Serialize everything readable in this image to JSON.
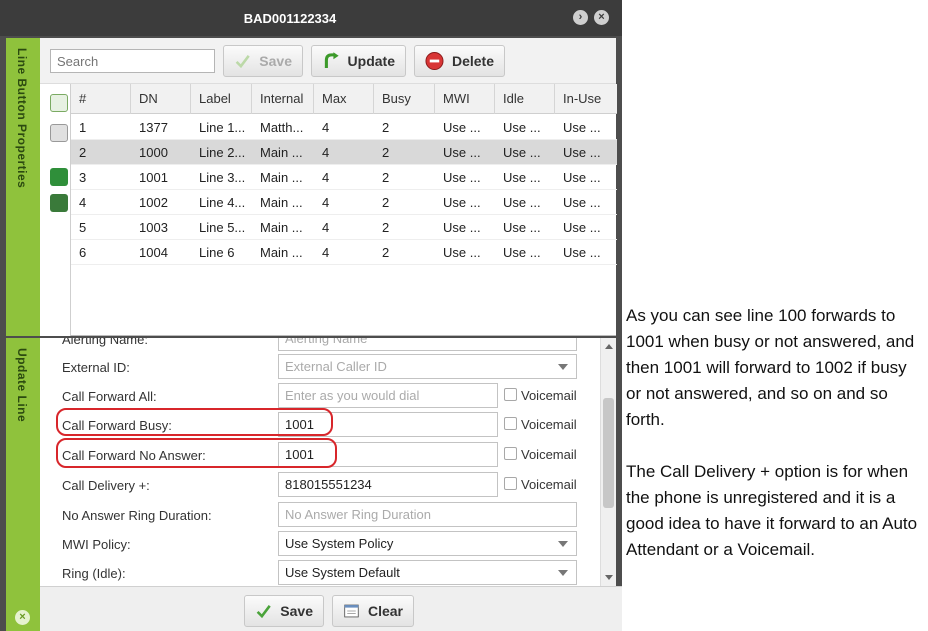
{
  "window": {
    "title": "BAD001122334",
    "tabs": {
      "line_button_properties": "Line Button Properties",
      "update_line": "Update Line"
    }
  },
  "toolbar": {
    "search_placeholder": "Search",
    "save_label": "Save",
    "update_label": "Update",
    "delete_label": "Delete"
  },
  "grid": {
    "columns": [
      "#",
      "DN",
      "Label",
      "Internal",
      "Max",
      "Busy",
      "MWI",
      "Idle",
      "In-Use"
    ],
    "rows": [
      [
        "1",
        "1377",
        "Line 1...",
        "Matth...",
        "4",
        "2",
        "Use ...",
        "Use ...",
        "Use ..."
      ],
      [
        "2",
        "1000",
        "Line 2...",
        "Main ...",
        "4",
        "2",
        "Use ...",
        "Use ...",
        "Use ..."
      ],
      [
        "3",
        "1001",
        "Line 3...",
        "Main ...",
        "4",
        "2",
        "Use ...",
        "Use ...",
        "Use ..."
      ],
      [
        "4",
        "1002",
        "Line 4...",
        "Main ...",
        "4",
        "2",
        "Use ...",
        "Use ...",
        "Use ..."
      ],
      [
        "5",
        "1003",
        "Line 5...",
        "Main ...",
        "4",
        "2",
        "Use ...",
        "Use ...",
        "Use ..."
      ],
      [
        "6",
        "1004",
        "Line 6",
        "Main ...",
        "4",
        "2",
        "Use ...",
        "Use ...",
        "Use ..."
      ]
    ],
    "selected_row": 2
  },
  "form": {
    "alerting_name": {
      "label": "Alerting Name:",
      "placeholder": "Alerting Name"
    },
    "external_id": {
      "label": "External ID:",
      "placeholder": "External Caller ID"
    },
    "call_forward_all": {
      "label": "Call Forward All:",
      "placeholder": "Enter as you would dial",
      "voicemail": "Voicemail"
    },
    "call_forward_busy": {
      "label": "Call Forward Busy:",
      "value": "1001",
      "voicemail": "Voicemail"
    },
    "call_forward_no_answer": {
      "label": "Call Forward No Answer:",
      "value": "1001",
      "voicemail": "Voicemail"
    },
    "call_delivery": {
      "label": "Call Delivery +:",
      "value": "818015551234",
      "voicemail": "Voicemail"
    },
    "no_answer_ring_duration": {
      "label": "No Answer Ring Duration:",
      "placeholder": "No Answer Ring Duration"
    },
    "mwi_policy": {
      "label": "MWI Policy:",
      "value": "Use System Policy"
    },
    "ring_idle": {
      "label": "Ring (Idle):",
      "value": "Use System Default"
    }
  },
  "footer": {
    "save_label": "Save",
    "clear_label": "Clear"
  },
  "notes": {
    "p1": "As you can see line 100 forwards to 1001 when busy or not answered, and then 1001 will forward to 1002 if busy or not answered, and so on and so forth.",
    "p2": "The Call Delivery + option is for when the phone is unregistered and it is a good idea to have it forward to an Auto Attendant or a Voicemail."
  },
  "colors": {
    "accent_green": "#8fc23c",
    "highlight_red": "#d8262b",
    "title_bar": "#3c3c3c"
  }
}
